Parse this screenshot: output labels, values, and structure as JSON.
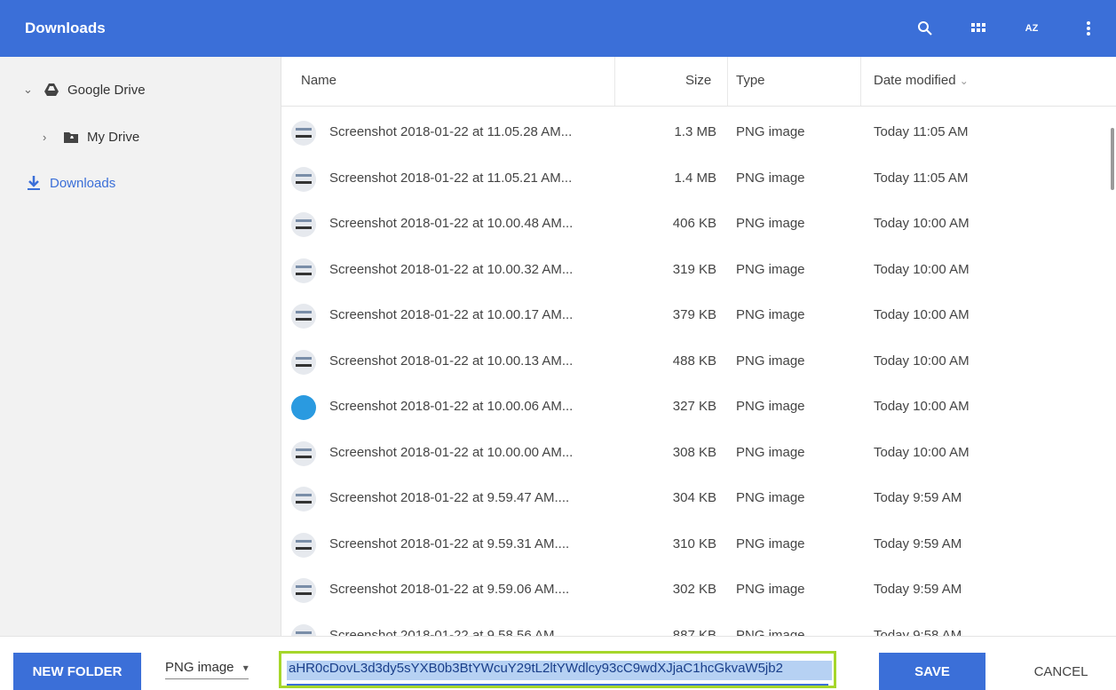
{
  "window": {
    "title": "Downloads"
  },
  "toolbar": {
    "icons": [
      "search-icon",
      "grid-view-icon",
      "sort-az-icon",
      "more-vert-icon"
    ],
    "sort_label": "AZ"
  },
  "sidebar": {
    "items": [
      {
        "label": "Google Drive",
        "icon": "google-drive-icon",
        "chevron": "⌄"
      },
      {
        "label": "My Drive",
        "icon": "folder-icon",
        "chevron": "›"
      },
      {
        "label": "Downloads",
        "icon": "download-icon",
        "active": true
      }
    ]
  },
  "columns": {
    "name": "Name",
    "size": "Size",
    "type": "Type",
    "date": "Date modified",
    "sort_indicator": "⌄"
  },
  "files": [
    {
      "name": "Screenshot 2018-01-22 at 11.05.28 AM...",
      "size": "1.3 MB",
      "type": "PNG image",
      "date": "Today 11:05 AM"
    },
    {
      "name": "Screenshot 2018-01-22 at 11.05.21 AM...",
      "size": "1.4 MB",
      "type": "PNG image",
      "date": "Today 11:05 AM"
    },
    {
      "name": "Screenshot 2018-01-22 at 10.00.48 AM...",
      "size": "406 KB",
      "type": "PNG image",
      "date": "Today 10:00 AM"
    },
    {
      "name": "Screenshot 2018-01-22 at 10.00.32 AM...",
      "size": "319 KB",
      "type": "PNG image",
      "date": "Today 10:00 AM"
    },
    {
      "name": "Screenshot 2018-01-22 at 10.00.17 AM...",
      "size": "379 KB",
      "type": "PNG image",
      "date": "Today 10:00 AM"
    },
    {
      "name": "Screenshot 2018-01-22 at 10.00.13 AM...",
      "size": "488 KB",
      "type": "PNG image",
      "date": "Today 10:00 AM"
    },
    {
      "name": "Screenshot 2018-01-22 at 10.00.06 AM...",
      "size": "327 KB",
      "type": "PNG image",
      "date": "Today 10:00 AM"
    },
    {
      "name": "Screenshot 2018-01-22 at 10.00.00 AM...",
      "size": "308 KB",
      "type": "PNG image",
      "date": "Today 10:00 AM"
    },
    {
      "name": "Screenshot 2018-01-22 at 9.59.47 AM....",
      "size": "304 KB",
      "type": "PNG image",
      "date": "Today 9:59 AM"
    },
    {
      "name": "Screenshot 2018-01-22 at 9.59.31 AM....",
      "size": "310 KB",
      "type": "PNG image",
      "date": "Today 9:59 AM"
    },
    {
      "name": "Screenshot 2018-01-22 at 9.59.06 AM....",
      "size": "302 KB",
      "type": "PNG image",
      "date": "Today 9:59 AM"
    },
    {
      "name": "Screenshot 2018-01-22 at 9.58.56 AM....",
      "size": "887 KB",
      "type": "PNG image",
      "date": "Today 9:58 AM"
    }
  ],
  "footer": {
    "new_folder_label": "NEW FOLDER",
    "file_type": "PNG image",
    "file_type_arrow": "▾",
    "filename": "aHR0cDovL3d3dy5sYXB0b3BtYWcuY29tL2ltYWdlcy93cC9wdXJjaC1hcGkvaW5jb2",
    "save_label": "SAVE",
    "cancel_label": "CANCEL"
  },
  "colors": {
    "accent": "#3b6fd8",
    "highlight_border": "#a6d62a",
    "selection": "#b6d1f3"
  }
}
